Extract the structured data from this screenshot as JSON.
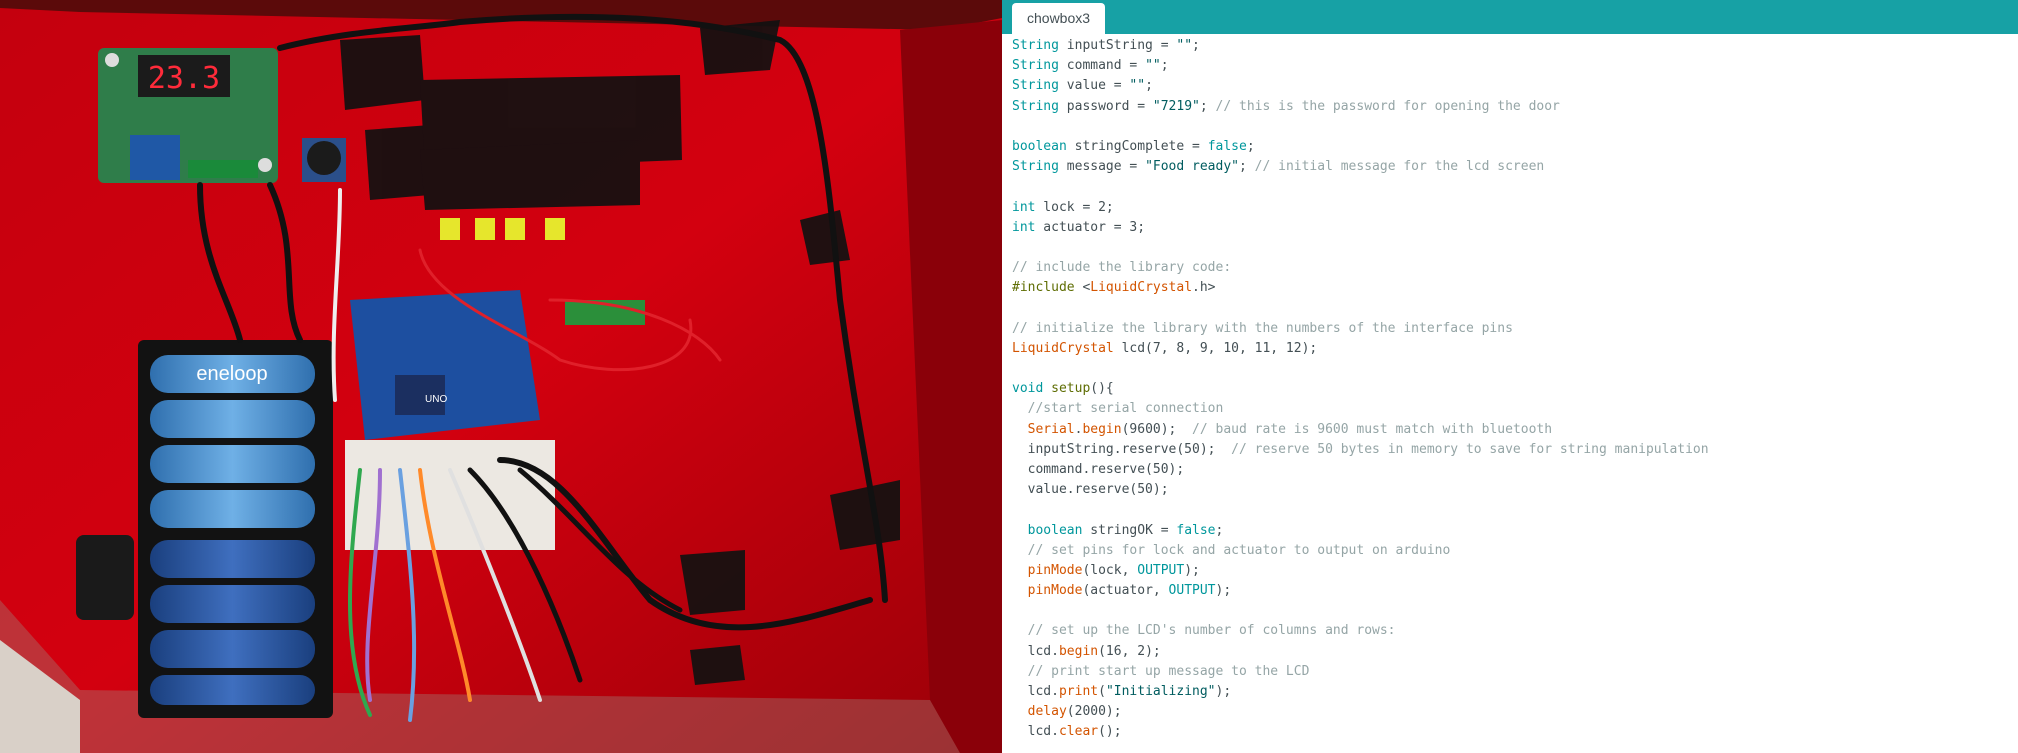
{
  "editor": {
    "tab_label": "chowbox3",
    "code": [
      [
        {
          "t": "String",
          "c": "kw"
        },
        {
          "t": " inputString = "
        },
        {
          "t": "\"\"",
          "c": "str"
        },
        {
          "t": ";"
        }
      ],
      [
        {
          "t": "String",
          "c": "kw"
        },
        {
          "t": " command = "
        },
        {
          "t": "\"\"",
          "c": "str"
        },
        {
          "t": ";"
        }
      ],
      [
        {
          "t": "String",
          "c": "kw"
        },
        {
          "t": " value = "
        },
        {
          "t": "\"\"",
          "c": "str"
        },
        {
          "t": ";"
        }
      ],
      [
        {
          "t": "String",
          "c": "kw"
        },
        {
          "t": " password = "
        },
        {
          "t": "\"7219\"",
          "c": "str"
        },
        {
          "t": "; "
        },
        {
          "t": "// this is the password for opening the door",
          "c": "cm"
        }
      ],
      [],
      [
        {
          "t": "boolean",
          "c": "kw"
        },
        {
          "t": " stringComplete = "
        },
        {
          "t": "false",
          "c": "kw"
        },
        {
          "t": ";"
        }
      ],
      [
        {
          "t": "String",
          "c": "kw"
        },
        {
          "t": " message = "
        },
        {
          "t": "\"Food ready\"",
          "c": "str"
        },
        {
          "t": "; "
        },
        {
          "t": "// initial message for the lcd screen",
          "c": "cm"
        }
      ],
      [],
      [
        {
          "t": "int",
          "c": "kw"
        },
        {
          "t": " lock = 2;"
        }
      ],
      [
        {
          "t": "int",
          "c": "kw"
        },
        {
          "t": " actuator = 3;"
        }
      ],
      [],
      [
        {
          "t": "// include the library code:",
          "c": "cm"
        }
      ],
      [
        {
          "t": "#include",
          "c": "pp"
        },
        {
          "t": " <"
        },
        {
          "t": "LiquidCrystal",
          "c": "fn"
        },
        {
          "t": ".h>"
        }
      ],
      [],
      [
        {
          "t": "// initialize the library with the numbers of the interface pins",
          "c": "cm"
        }
      ],
      [
        {
          "t": "LiquidCrystal",
          "c": "fn"
        },
        {
          "t": " lcd(7, 8, 9, 10, 11, 12);"
        }
      ],
      [],
      [
        {
          "t": "void",
          "c": "kw"
        },
        {
          "t": " "
        },
        {
          "t": "setup",
          "c": "pp"
        },
        {
          "t": "(){"
        }
      ],
      [
        {
          "t": "  "
        },
        {
          "t": "//start serial connection",
          "c": "cm"
        }
      ],
      [
        {
          "t": "  "
        },
        {
          "t": "Serial",
          "c": "fn"
        },
        {
          "t": "."
        },
        {
          "t": "begin",
          "c": "fn"
        },
        {
          "t": "(9600);  "
        },
        {
          "t": "// baud rate is 9600 must match with bluetooth",
          "c": "cm"
        }
      ],
      [
        {
          "t": "  inputString.reserve(50);  "
        },
        {
          "t": "// reserve 50 bytes in memory to save for string manipulation",
          "c": "cm"
        }
      ],
      [
        {
          "t": "  command.reserve(50);"
        }
      ],
      [
        {
          "t": "  value.reserve(50);"
        }
      ],
      [],
      [
        {
          "t": "  "
        },
        {
          "t": "boolean",
          "c": "kw"
        },
        {
          "t": " stringOK = "
        },
        {
          "t": "false",
          "c": "kw"
        },
        {
          "t": ";"
        }
      ],
      [
        {
          "t": "  "
        },
        {
          "t": "// set pins for lock and actuator to output on arduino",
          "c": "cm"
        }
      ],
      [
        {
          "t": "  "
        },
        {
          "t": "pinMode",
          "c": "fn"
        },
        {
          "t": "(lock, "
        },
        {
          "t": "OUTPUT",
          "c": "kw"
        },
        {
          "t": ");"
        }
      ],
      [
        {
          "t": "  "
        },
        {
          "t": "pinMode",
          "c": "fn"
        },
        {
          "t": "(actuator, "
        },
        {
          "t": "OUTPUT",
          "c": "kw"
        },
        {
          "t": ");"
        }
      ],
      [],
      [
        {
          "t": "  "
        },
        {
          "t": "// set up the LCD's number of columns and rows:",
          "c": "cm"
        }
      ],
      [
        {
          "t": "  lcd."
        },
        {
          "t": "begin",
          "c": "fn"
        },
        {
          "t": "(16, 2);"
        }
      ],
      [
        {
          "t": "  "
        },
        {
          "t": "// print start up message to the LCD",
          "c": "cm"
        }
      ],
      [
        {
          "t": "  lcd."
        },
        {
          "t": "print",
          "c": "fn"
        },
        {
          "t": "("
        },
        {
          "t": "\"Initializing\"",
          "c": "str"
        },
        {
          "t": ");"
        }
      ],
      [
        {
          "t": "  "
        },
        {
          "t": "delay",
          "c": "fn"
        },
        {
          "t": "(2000);"
        }
      ],
      [
        {
          "t": "  lcd."
        },
        {
          "t": "clear",
          "c": "fn"
        },
        {
          "t": "();"
        }
      ]
    ]
  },
  "photo": {
    "lcd_display": "23.3",
    "battery_brand": "eneloop",
    "board_label": "UNO"
  },
  "colors": {
    "tab_bar": "#17a1a5",
    "keyword": "#00979c",
    "function": "#d35400",
    "preprocessor": "#5e6d03",
    "string": "#005c5f",
    "comment": "#95a5a6",
    "enclosure": "#b3000a"
  }
}
